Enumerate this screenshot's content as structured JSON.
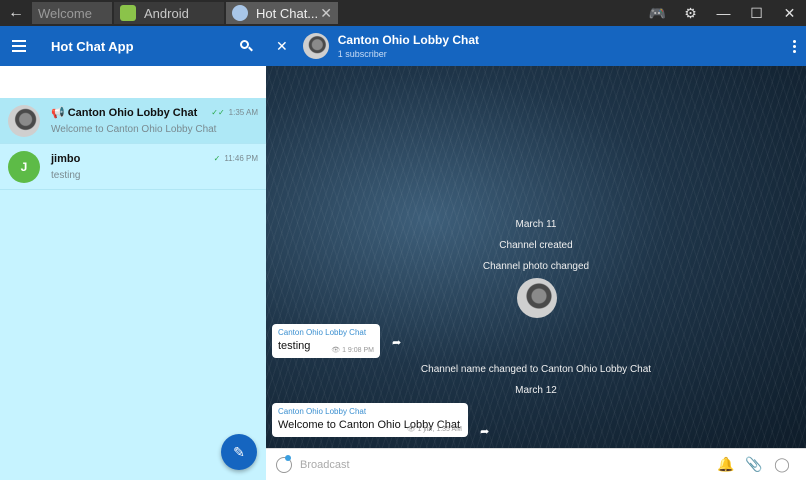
{
  "tabs": [
    {
      "label": "Welcome"
    },
    {
      "label": "Android"
    },
    {
      "label": "Hot Chat..."
    }
  ],
  "window_controls": [
    "gamepad-icon",
    "gear-icon",
    "minimize-icon",
    "maximize-icon",
    "close-icon"
  ],
  "sidebar": {
    "title": "Hot Chat App",
    "chats": [
      {
        "name": "Canton Ohio Lobby Chat",
        "time": "1:35 AM",
        "preview": "Welcome to Canton Ohio Lobby Chat"
      },
      {
        "name": "jimbo",
        "avatar_letter": "J",
        "time": "11:46 PM",
        "preview": "testing"
      }
    ]
  },
  "channel": {
    "name": "Canton Ohio Lobby Chat",
    "subtitle": "1 subscriber"
  },
  "messages": {
    "date1": "March 11",
    "created": "Channel created",
    "photo_changed": "Channel photo changed",
    "m1": {
      "author": "Canton Ohio Lobby Chat",
      "text": "testing",
      "views": "1",
      "time": "9:08 PM"
    },
    "name_changed": "Channel name changed to Canton Ohio Lobby Chat",
    "date2": "March 12",
    "m2": {
      "author": "Canton Ohio Lobby Chat",
      "text": "Welcome to Canton Ohio Lobby Chat",
      "views": "1",
      "signature": "jim, 1:35 AM"
    }
  },
  "composer": {
    "placeholder": "Broadcast"
  },
  "colors": {
    "header": "#1565c0",
    "sidebar_bg": "#c6f3ff",
    "accent_green": "#2aa84a",
    "link_blue": "#3a8fd0"
  }
}
